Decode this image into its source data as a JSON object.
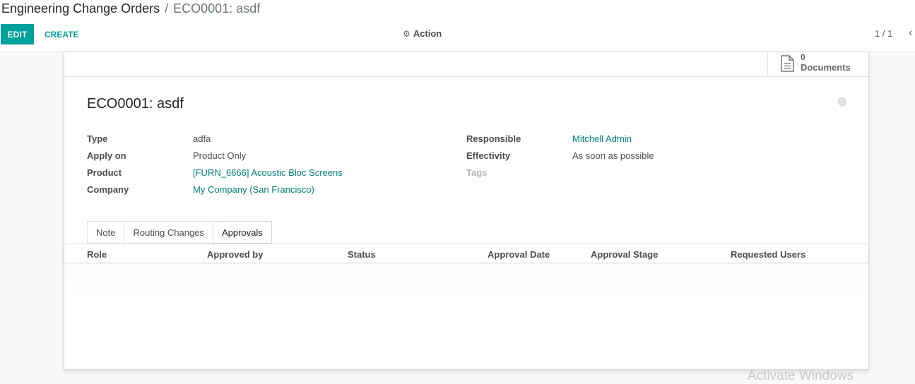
{
  "breadcrumb": {
    "parent": "Engineering Change Orders",
    "separator": "/",
    "current": "ECO0001: asdf"
  },
  "toolbar": {
    "edit_label": "EDIT",
    "create_label": "CREATE",
    "action_label": "Action",
    "pager": "1 / 1"
  },
  "smart_button": {
    "count": "0",
    "label": "Documents"
  },
  "record": {
    "title": "ECO0001: asdf"
  },
  "fields_left": [
    {
      "label": "Type",
      "value": "adfa"
    },
    {
      "label": "Apply on",
      "value": "Product Only"
    },
    {
      "label": "Product",
      "value": "[FURN_6666] Acoustic Bloc Screens"
    },
    {
      "label": "Company",
      "value": "My Company (San Francisco)"
    }
  ],
  "fields_right": [
    {
      "label": "Responsible",
      "value": "Mitchell Admin"
    },
    {
      "label": "Effectivity",
      "value": "As soon as possible"
    },
    {
      "label": "Tags",
      "value": ""
    }
  ],
  "tabs": [
    {
      "label": "Note"
    },
    {
      "label": "Routing Changes"
    },
    {
      "label": "Approvals"
    }
  ],
  "approvals_table": {
    "columns": [
      "Role",
      "Approved by",
      "Status",
      "Approval Date",
      "Approval Stage",
      "Requested Users"
    ]
  },
  "watermark": "Activate Windows",
  "colors": {
    "accent": "#00a09d",
    "link": "#00807c"
  }
}
